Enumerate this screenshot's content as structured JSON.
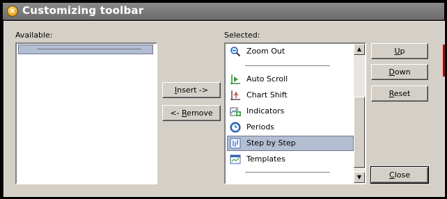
{
  "window": {
    "title": "Customizing toolbar"
  },
  "available": {
    "label": "Available:",
    "items": [
      {
        "type": "separator",
        "selected": true
      }
    ]
  },
  "selected": {
    "label": "Selected:",
    "items": [
      {
        "label": "Zoom Out",
        "icon": "zoom-out-icon"
      },
      {
        "type": "separator"
      },
      {
        "label": "Auto Scroll",
        "icon": "auto-scroll-icon"
      },
      {
        "label": "Chart Shift",
        "icon": "chart-shift-icon"
      },
      {
        "label": "Indicators",
        "icon": "indicators-icon"
      },
      {
        "label": "Periods",
        "icon": "periods-icon"
      },
      {
        "label": "Step by Step",
        "icon": "step-by-step-icon",
        "selected": true
      },
      {
        "label": "Templates",
        "icon": "templates-icon"
      },
      {
        "type": "separator"
      }
    ]
  },
  "buttons": {
    "insert": "Insert ->",
    "remove": "<- Remove",
    "up": "Up",
    "down": "Down",
    "reset": "Reset",
    "close": "Close"
  },
  "mnemonics": {
    "insert": "I",
    "remove": "R",
    "up": "U",
    "down": "D",
    "reset": "R",
    "close": "C"
  },
  "colors": {
    "selection_bg": "#b4bed2",
    "dialog_bg": "#d4d0c8",
    "title_text": "#ffffff"
  }
}
